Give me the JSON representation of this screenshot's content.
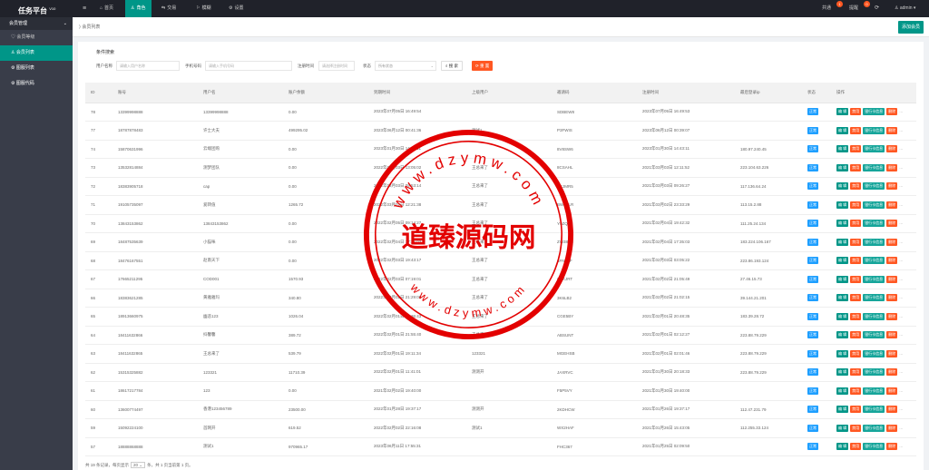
{
  "app": {
    "title": "任务平台",
    "version": "V10"
  },
  "topnav": {
    "items": [
      {
        "icon": "≡"
      },
      {
        "icon": "⌂",
        "label": "首页"
      },
      {
        "icon": "♙",
        "label": "角色",
        "active": true
      },
      {
        "icon": "⇆",
        "label": "交易"
      },
      {
        "icon": "⚐",
        "label": "模糊"
      },
      {
        "icon": "⚙",
        "label": "设置"
      }
    ],
    "right": {
      "alert_label": "共通",
      "alert_badge": "1",
      "msg_label": "提醒",
      "msg_badge": "0",
      "refresh_icon": "⟳",
      "user_label": "admin",
      "user_caret": "▾"
    }
  },
  "sidebar": {
    "group": "会员管理",
    "chevron": "⌄",
    "items": [
      {
        "icon": "♡",
        "label": "会员等级"
      },
      {
        "icon": "♙",
        "label": "会员列表",
        "active": true
      },
      {
        "icon": "⚙",
        "label": "图服列表"
      },
      {
        "icon": "⚙",
        "label": "图服代码"
      }
    ]
  },
  "tabbar": {
    "crumb": "⟩ 会员列表",
    "add_button": "添加会员"
  },
  "search": {
    "title": "条件搜索",
    "user_label": "用户名称",
    "user_placeholder": "请输入用户名称",
    "phone_label": "手机号码",
    "phone_placeholder": "请输入手机号码",
    "time_label": "注册时间",
    "time_placeholder": "请选择注册时间",
    "status_label": "状态",
    "status_value": "所有状态",
    "search_btn": "搜 索",
    "reset_btn": "重 置"
  },
  "table": {
    "headers": [
      "ID",
      "账号",
      "用户名",
      "账户余额",
      "到期时间",
      "上级用户",
      "邀请码",
      "注册时间",
      "最后登录ip",
      "状态",
      "操作"
    ],
    "rows": [
      [
        "78",
        "13399998888",
        "13399998888",
        "0.00",
        "2023年07月05日 16:49:54",
        "",
        "SDBEW8",
        "2023年07月05日 16:49:53",
        ""
      ],
      [
        "77",
        "18787878483",
        "许士大夫",
        "499295.02",
        "2023年06月12日 00:41:36",
        "测试1",
        "P3FWIS",
        "2023年06月12日 00:39:07",
        ""
      ],
      [
        "74",
        "15870631996",
        "云端团购",
        "0.00",
        "2023年01月30日 14:43:11",
        "",
        "8V8SW6",
        "2023年01月30日 14:43:11",
        "180.97.240.45"
      ],
      [
        "73",
        "13532814884",
        "测梦团队",
        "0.00",
        "2022年03月03日 13:05:02",
        "王总来了",
        "8CSAHL",
        "2021年03月03日 12:11:52",
        "223.104.63.226"
      ],
      [
        "72",
        "18383905718",
        "cap",
        "0.00",
        "2022年03月03日 09:53:14",
        "王总来了",
        "EXJMR5",
        "2021年03月03日 09:26:27",
        "117.136.64.24"
      ],
      [
        "71",
        "19105735097",
        "爱转值",
        "1265.72",
        "2022年03月02日 12:21:38",
        "王总来了",
        "BW8TLR",
        "2021年03月02日 23:33:29",
        "113.15.2.88"
      ],
      [
        "70",
        "13843153862",
        "13843153862",
        "0.00",
        "2022年02月05日 09:14:27",
        "王总来了",
        "Y9ZQ1L",
        "2021年02月04日 19:42:32",
        "111.25.24.134"
      ],
      [
        "69",
        "18487535639",
        "小猫咪",
        "0.00",
        "2022年02月04日 17:35:03",
        "王总来了",
        "ZW38FN",
        "2021年02月04日 17:35:03",
        "183.224.106.167"
      ],
      [
        "68",
        "18476167551",
        "赵南天下",
        "0.00",
        "2022年02月03日 19:43:17",
        "王总来了",
        "6FN2SF",
        "2021年02月03日 03:05:22",
        "223.86.193.124"
      ],
      [
        "67",
        "17665211295",
        "COD001",
        "1570.93",
        "2022年02月03日 07:19:01",
        "王总来了",
        "GLKJRT",
        "2021年02月02日 21:05:49",
        "27.46.15.73"
      ],
      [
        "66",
        "18383621285",
        "黄雅雅玛",
        "340.80",
        "2022年02月02日 21:29:09",
        "王总来了",
        "3K6LB2",
        "2021年02月02日 21:02:15",
        "39.144.21.201"
      ],
      [
        "65",
        "18913660975",
        "幽悲123",
        "1026.04",
        "2022年02月01日 20:36:43",
        "王总来了",
        "CGE5BY",
        "2021年02月01日 20:48:35",
        "183.39.28.72"
      ],
      [
        "64",
        "18411632866",
        "抖馨馨",
        "389.72",
        "2022年02月01日 21:55:40",
        "王总来了",
        "ABSUNT",
        "2021年02月01日 02:12:27",
        "223.88.79.229"
      ],
      [
        "63",
        "18411632865",
        "王总来了",
        "539.79",
        "2022年02月01日 19:11:34",
        "123321",
        "MGEHSB",
        "2021年02月01日 02:01:46",
        "223.88.79.229"
      ],
      [
        "62",
        "15315325882",
        "123321",
        "11710.39",
        "2022年02月01日 11:41:01",
        "测测开",
        "JAXRVC",
        "2021年01月30日 20:18:33",
        "223.88.79.229"
      ],
      [
        "61",
        "18617217784",
        "123",
        "0.00",
        "2021年02月02日 19:40:00",
        "",
        "F5P5VY",
        "2021年01月30日 19:40:00",
        ""
      ],
      [
        "60",
        "13600774497",
        "香港123456789",
        "23500.00",
        "2022年01月28日 19:37:17",
        "测测开",
        "2KDHCW",
        "2021年01月26日 19:37:17",
        "112.47.231.79"
      ],
      [
        "59",
        "15092224100",
        "首网开",
        "619.52",
        "2022年02月02日 22:16:08",
        "测试1",
        "WX2HAF",
        "2021年01月26日 15:43:05",
        "112.255.33.124"
      ],
      [
        "57",
        "18888868888",
        "测试1",
        "970965.17",
        "2023年06月11日 17:55:31",
        "",
        "FHC367",
        "2021年01月25日 02:09:50",
        ""
      ]
    ],
    "status_label": "正常",
    "actions": [
      "编 辑",
      "禁用",
      "银行卡信息",
      "删除",
      "…"
    ]
  },
  "footer": {
    "prefix": "共 19 条记录，每页显示",
    "page_size": "20",
    "suffix": "条，共 1 页当前第 1 页。"
  },
  "watermark": {
    "url": "www.dzymw.com",
    "name": "道臻源码网"
  },
  "colors": {
    "primary": "#009688",
    "danger": "#ff5722",
    "info": "#1e9fff",
    "topbar": "#20222a",
    "sidebar": "#393d49"
  }
}
